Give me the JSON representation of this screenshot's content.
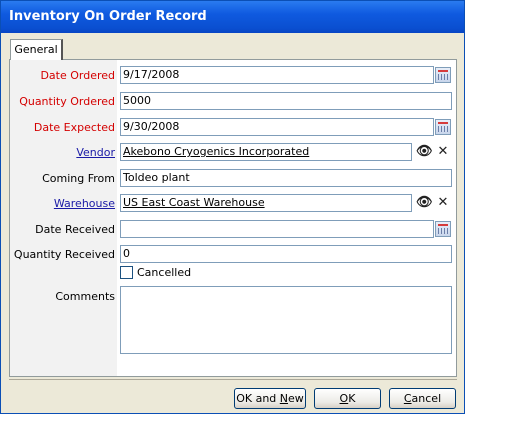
{
  "window": {
    "title": "Inventory On Order Record"
  },
  "tabs": [
    {
      "label": "General"
    }
  ],
  "form": {
    "date_ordered": {
      "label": "Date Ordered",
      "value": "9/17/2008"
    },
    "quantity_ordered": {
      "label": "Quantity Ordered",
      "value": "5000"
    },
    "date_expected": {
      "label": "Date Expected",
      "value": "9/30/2008"
    },
    "vendor": {
      "label": "Vendor",
      "value": "Akebono Cryogenics Incorporated"
    },
    "coming_from": {
      "label": "Coming From",
      "value": "Toldeo plant"
    },
    "warehouse": {
      "label": "Warehouse",
      "value": "US East Coast Warehouse"
    },
    "date_received": {
      "label": "Date Received",
      "value": ""
    },
    "quantity_received": {
      "label": "Quantity Received",
      "value": "0"
    },
    "cancelled": {
      "label": "Cancelled",
      "checked": false
    },
    "comments": {
      "label": "Comments",
      "value": ""
    }
  },
  "buttons": {
    "ok_and_new": {
      "pre": "OK and ",
      "key": "N",
      "post": "ew"
    },
    "ok": {
      "pre": "",
      "key": "O",
      "post": "K"
    },
    "cancel": {
      "pre": "",
      "key": "C",
      "post": "ancel"
    }
  },
  "icons": {
    "calendar": "calendar-icon",
    "lookup": "binoculars-icon",
    "clear": "clear-x-icon"
  },
  "colors": {
    "required_label": "#d40000",
    "link_label": "#1a1aa6",
    "titlebar": "#0a4fd0"
  }
}
